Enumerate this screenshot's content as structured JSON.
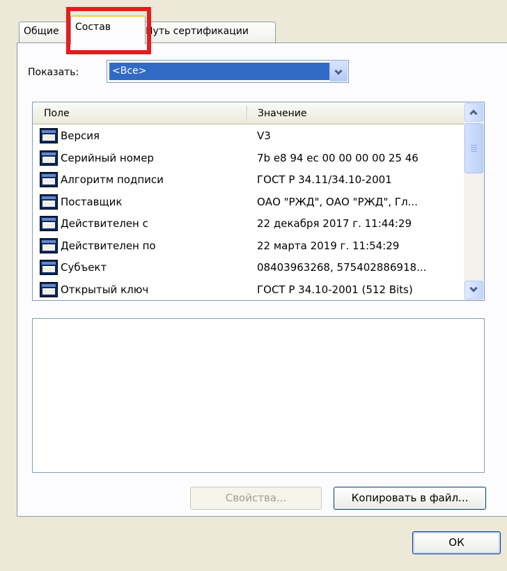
{
  "tabs": {
    "general": "Общие",
    "details": "Состав",
    "path": "Путь сертификации"
  },
  "show": {
    "label": "Показать:",
    "selected": "<Все>"
  },
  "list": {
    "headers": {
      "field": "Поле",
      "value": "Значение"
    },
    "rows": [
      {
        "field": "Версия",
        "value": "V3"
      },
      {
        "field": "Серийный номер",
        "value": "7b e8 94 ec 00 00 00 00 25 46"
      },
      {
        "field": "Алгоритм подписи",
        "value": "ГОСТ Р 34.11/34.10-2001"
      },
      {
        "field": "Поставщик",
        "value": "ОАО \"РЖД\", ОАО \"РЖД\", Гл..."
      },
      {
        "field": "Действителен с",
        "value": "22 декабря 2017 г. 11:44:29"
      },
      {
        "field": "Действителен по",
        "value": "22 марта 2019 г. 11:54:29"
      },
      {
        "field": "Субъект",
        "value": "08403963268, 575402886918..."
      },
      {
        "field": "Открытый ключ",
        "value": "ГОСТ Р 34.10-2001 (512 Bits)"
      }
    ]
  },
  "buttons": {
    "properties": "Свойства...",
    "copy_to_file": "Копировать в файл...",
    "ok": "ОК"
  },
  "colors": {
    "highlight": "#e41d1d",
    "selection": "#316ac5"
  }
}
